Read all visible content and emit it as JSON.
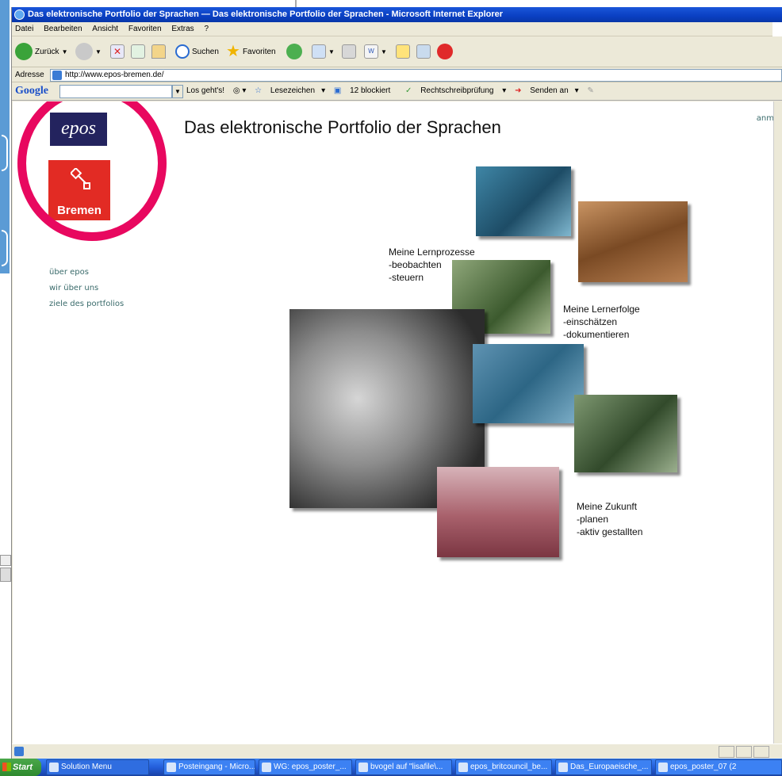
{
  "window": {
    "title": "Das elektronische Portfolio der Sprachen — Das elektronische Portfolio der Sprachen - Microsoft Internet Explorer"
  },
  "menubar": {
    "items": [
      "Datei",
      "Bearbeiten",
      "Ansicht",
      "Favoriten",
      "Extras",
      "?"
    ]
  },
  "toolbar": {
    "back_label": "Zurück",
    "search_label": "Suchen",
    "favorites_label": "Favoriten"
  },
  "address": {
    "label": "Adresse",
    "url": "http://www.epos-bremen.de/"
  },
  "google_bar": {
    "logo": "Google",
    "go_label": "Los geht's!",
    "bookmarks_label": "Lesezeichen",
    "blocked_label": "12 blockiert",
    "spellcheck_label": "Rechtschreibprüfung",
    "send_label": "Senden an"
  },
  "page": {
    "title": "Das elektronische Portfolio der Sprachen",
    "corner_link": "anm",
    "epos_logo": "epos",
    "bremen_logo": "Bremen",
    "nav": [
      "über epos",
      "wir über uns",
      "ziele des portfolios"
    ],
    "captions": {
      "lernprozesse": [
        "Meine Lernprozesse",
        "-beobachten",
        "-steuern"
      ],
      "lernerfolge": [
        "Meine Lernerfolge",
        "-einschätzen",
        "-dokumentieren"
      ],
      "zukunft": [
        "Meine Zukunft",
        "-planen",
        "-aktiv gestallten"
      ]
    }
  },
  "taskbar": {
    "start_label": "Start",
    "tasks": [
      "Solution Menu",
      "Posteingang - Micro...",
      "WG: epos_poster_...",
      "bvogel auf \"lisafile\\...",
      "epos_britcouncil_be...",
      "Das_Europaeische_...",
      "epos_poster_07 (2"
    ]
  },
  "colors": {
    "title_blue": "#0a3fc2",
    "highlight_circle": "#e8085f",
    "bremen_red": "#e22b24",
    "epos_navy": "#23235e",
    "nav_link": "#3a6b6b"
  }
}
